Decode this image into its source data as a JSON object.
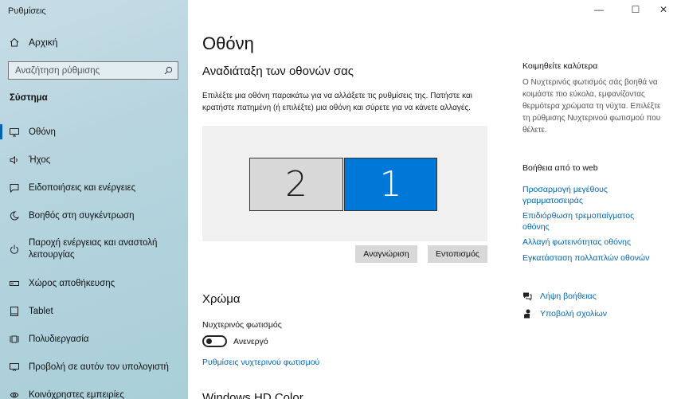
{
  "window": {
    "title": "Ρυθμίσεις",
    "controls": [
      "—",
      "☐",
      "✕"
    ]
  },
  "sidebar": {
    "home_label": "Αρχική",
    "search_placeholder": "Αναζήτηση ρύθμισης",
    "section_title": "Σύστημα",
    "items": [
      {
        "label": "Οθόνη",
        "icon": "monitor-icon",
        "active": true
      },
      {
        "label": "Ήχος",
        "icon": "speaker-icon"
      },
      {
        "label": "Ειδοποιήσεις και ενέργειες",
        "icon": "notification-icon"
      },
      {
        "label": "Βοηθός στη συγκέντρωση",
        "icon": "moon-icon"
      },
      {
        "label": "Παροχή ενέργειας και αναστολή λειτουργίας",
        "icon": "power-icon"
      },
      {
        "label": "Χώρος αποθήκευσης",
        "icon": "storage-icon"
      },
      {
        "label": "Tablet",
        "icon": "tablet-icon"
      },
      {
        "label": "Πολυδιεργασία",
        "icon": "multitasking-icon"
      },
      {
        "label": "Προβολή σε αυτόν τον υπολογιστή",
        "icon": "projecting-icon"
      },
      {
        "label": "Κοινόχρηστες εμπειρίες",
        "icon": "shared-icon"
      }
    ]
  },
  "main": {
    "page_title": "Οθόνη",
    "arrange_heading": "Αναδιάταξη των οθονών σας",
    "arrange_desc": "Επιλέξτε μια οθόνη παρακάτω για να αλλάξετε τις ρυθμίσεις της. Πατήστε και κρατήστε πατημένη (ή επιλέξτε) μια οθόνη και σύρετε για να κάνετε αλλαγές.",
    "monitor_2": "2",
    "monitor_1": "1",
    "identify_button": "Αναγνώριση",
    "detect_button": "Εντοπισμός",
    "color_heading": "Χρώμα",
    "night_light_label": "Νυχτερινός φωτισμός",
    "night_light_state": "Ανενεργό",
    "night_light_link": "Ρυθμίσεις νυχτερινού φωτισμού",
    "next_heading": "Windows HD Color"
  },
  "right": {
    "sleep_heading": "Κοιμηθείτε καλύτερα",
    "sleep_text": "Ο Νυχτερινός φωτισμός σάς βοηθά να κοιμάστε πιο εύκολα, εμφανίζοντας θερμότερα χρώματα τη νύχτα. Επιλέξτε τη ρύθμισης Νυχτερινού φωτισμού που θέλετε.",
    "web_help_heading": "Βοήθεια από το web",
    "links": [
      "Προσαρμογή μεγέθους γραμματοσειράς",
      "Επιδιόρθωση τρεμοπαίγματος οθόνης",
      "Αλλαγή φωτεινότητας οθόνης",
      "Εγκατάσταση πολλαπλών οθονών"
    ],
    "get_help": "Λήψη βοήθειας",
    "feedback": "Υποβολή σχολίων"
  },
  "colors": {
    "accent": "#0078d7",
    "link": "#0067b8"
  }
}
